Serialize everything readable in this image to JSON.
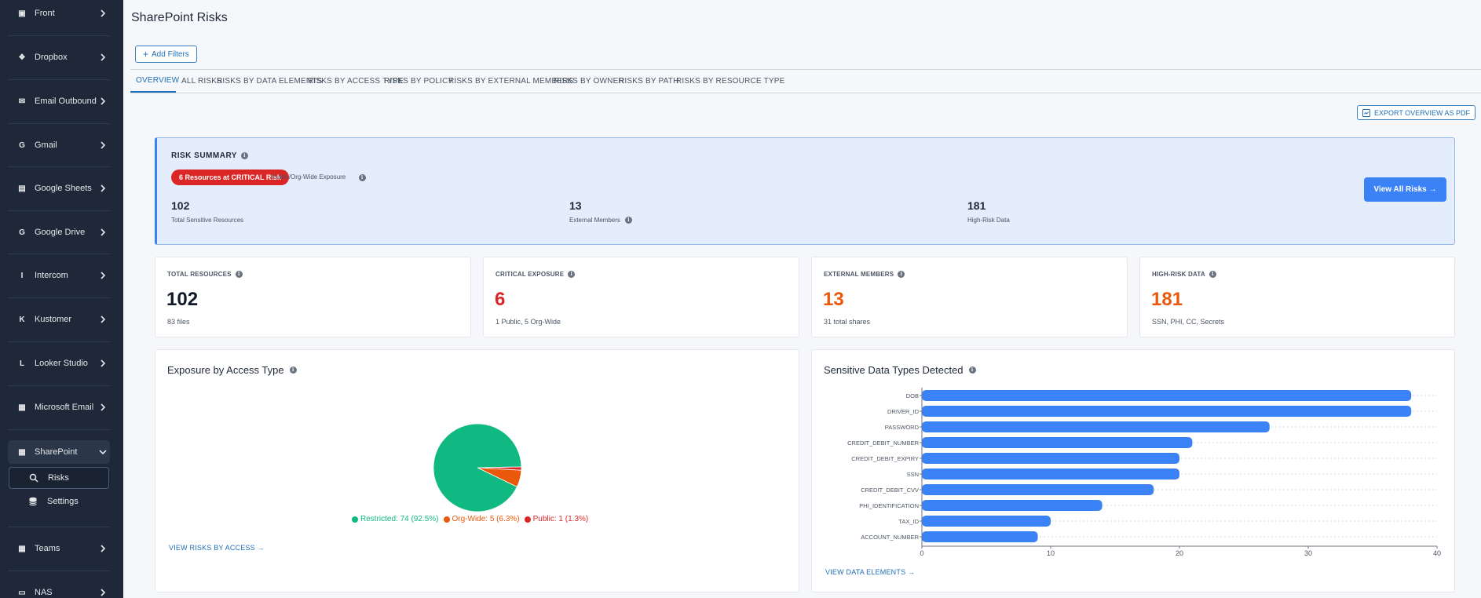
{
  "sidebar": {
    "items": [
      {
        "label": "Front",
        "icon": "square-icon",
        "glyph": "▣"
      },
      {
        "label": "Dropbox",
        "icon": "dropbox-icon",
        "glyph": "❖"
      },
      {
        "label": "Email Outbound",
        "icon": "email-icon",
        "glyph": "✉"
      },
      {
        "label": "Gmail",
        "icon": "gmail-icon",
        "glyph": "G"
      },
      {
        "label": "Google Sheets",
        "icon": "document-icon",
        "glyph": "▤"
      },
      {
        "label": "Google Drive",
        "icon": "google-drive-icon",
        "glyph": "G"
      },
      {
        "label": "Intercom",
        "icon": "intercom-icon",
        "glyph": "I"
      },
      {
        "label": "Kustomer",
        "icon": "kustomer-icon",
        "glyph": "K"
      },
      {
        "label": "Looker Studio",
        "icon": "looker-icon",
        "glyph": "L"
      },
      {
        "label": "Microsoft Email",
        "icon": "windows-icon",
        "glyph": "▦"
      },
      {
        "label": "SharePoint",
        "icon": "sharepoint-icon",
        "glyph": "▦"
      },
      {
        "label": "Teams",
        "icon": "teams-icon",
        "glyph": "▦"
      },
      {
        "label": "NAS",
        "icon": "server-icon",
        "glyph": "▭"
      }
    ],
    "sub_items": [
      {
        "label": "Risks",
        "icon": "search-icon"
      },
      {
        "label": "Settings",
        "icon": "database-icon"
      }
    ]
  },
  "page": {
    "title": "SharePoint Risks",
    "add_filters": "Add Filters",
    "export": "EXPORT OVERVIEW AS PDF"
  },
  "tabs": [
    "OVERVIEW",
    "ALL RISKS",
    "RISKS BY DATA ELEMENTS",
    "RISKS BY ACCESS TYPE",
    "RISKS BY POLICY",
    "RISKS BY EXTERNAL MEMBERS",
    "RISKS BY OWNER",
    "RISKS BY PATH",
    "RISKS BY RESOURCE TYPE"
  ],
  "risk_summary": {
    "title": "RISK SUMMARY",
    "critical_pill": "6 Resources at CRITICAL Risk",
    "exposure_label": "Public/Org-Wide Exposure",
    "stats": [
      {
        "value": "102",
        "label": "Total Sensitive Resources"
      },
      {
        "value": "13",
        "label": "External Members"
      },
      {
        "value": "181",
        "label": "High-Risk Data"
      }
    ],
    "view_all": "View All Risks →"
  },
  "cards": [
    {
      "title": "TOTAL RESOURCES",
      "value": "102",
      "sub": "83 files",
      "color": "#111827"
    },
    {
      "title": "CRITICAL EXPOSURE",
      "value": "6",
      "sub": "1 Public, 5 Org-Wide",
      "color": "#dc2626"
    },
    {
      "title": "EXTERNAL MEMBERS",
      "value": "13",
      "sub": "31 total shares",
      "color": "#ea580c"
    },
    {
      "title": "HIGH-RISK DATA",
      "value": "181",
      "sub": "SSN, PHI, CC, Secrets",
      "color": "#ea580c"
    }
  ],
  "exposure_panel": {
    "title": "Exposure by Access Type",
    "link": "VIEW RISKS BY ACCESS →",
    "legend": [
      {
        "label": "Restricted: 74 (92.5%)",
        "color": "#10b981"
      },
      {
        "label": "Org-Wide: 5 (6.3%)",
        "color": "#ea580c"
      },
      {
        "label": "Public: 1 (1.3%)",
        "color": "#dc2626"
      }
    ]
  },
  "sensitive_panel": {
    "title": "Sensitive Data Types Detected",
    "link": "VIEW DATA ELEMENTS →"
  },
  "chart_data": [
    {
      "type": "pie",
      "title": "Exposure by Access Type",
      "labels": [
        "Restricted",
        "Org-Wide",
        "Public"
      ],
      "values": [
        74,
        5,
        1
      ],
      "colors": [
        "#10b981",
        "#ea580c",
        "#dc2626"
      ]
    },
    {
      "type": "bar",
      "orientation": "horizontal",
      "title": "Sensitive Data Types Detected",
      "categories": [
        "DOB",
        "DRIVER_ID",
        "PASSWORD",
        "CREDIT_DEBIT_NUMBER",
        "CREDIT_DEBIT_EXPIRY",
        "SSN",
        "CREDIT_DEBIT_CVV",
        "PHI_IDENTIFICATION",
        "TAX_ID",
        "ACCOUNT_NUMBER"
      ],
      "values": [
        38,
        38,
        27,
        21,
        20,
        20,
        18,
        14,
        10,
        9
      ],
      "xlim": [
        0,
        40
      ],
      "xticks": [
        0,
        10,
        20,
        30,
        40
      ],
      "color": "#3b82f6",
      "grid": true
    }
  ]
}
